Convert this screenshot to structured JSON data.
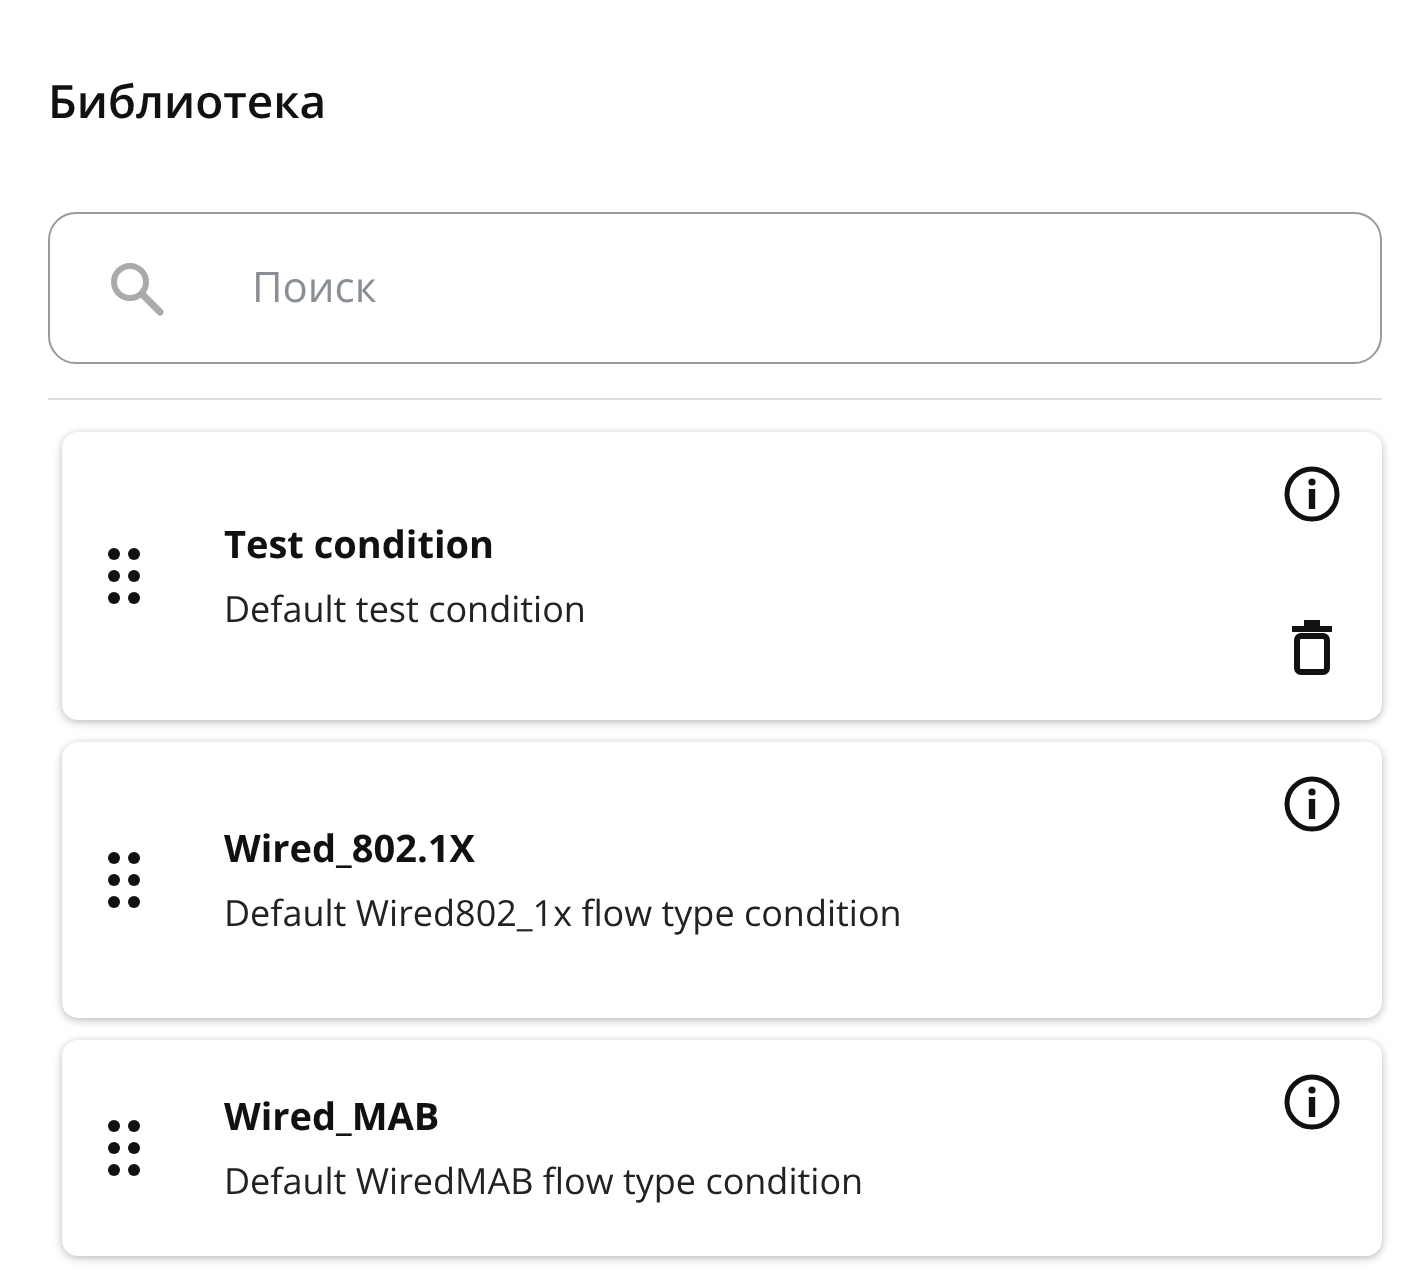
{
  "title": "Библиотека",
  "search": {
    "placeholder": "Поиск"
  },
  "items": [
    {
      "name": "Test condition",
      "description": "Default test condition",
      "deletable": true
    },
    {
      "name": "Wired_802.1X",
      "description": "Default Wired802_1x flow type condition",
      "deletable": false
    },
    {
      "name": "Wired_MAB",
      "description": "Default WiredMAB flow type condition",
      "deletable": false
    }
  ]
}
